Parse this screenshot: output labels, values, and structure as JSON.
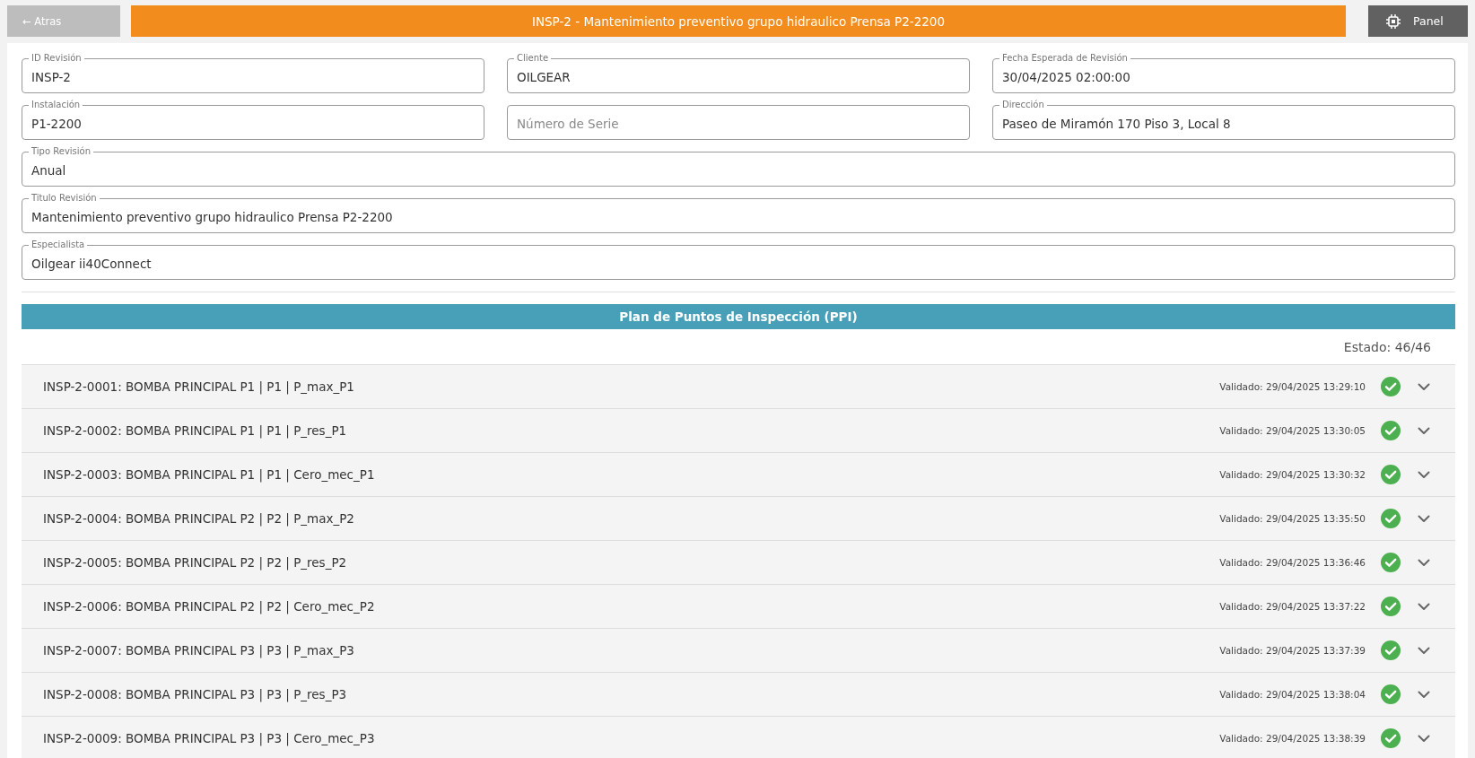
{
  "top_bar": {
    "back_button": "← Atras",
    "title": "INSP-2 - Mantenimiento preventivo grupo hidraulico Prensa P2-2200",
    "panel_button": "Panel"
  },
  "form": {
    "rows": [
      [
        {
          "label": "ID Revisión",
          "value": "INSP-2"
        },
        {
          "label": "Cliente",
          "value": "OILGEAR"
        },
        {
          "label": "Fecha Esperada de Revisión",
          "value": "30/04/2025 02:00:00"
        }
      ],
      [
        {
          "label": "Instalación",
          "value": "P1-2200"
        },
        {
          "placeholder": "Número de Serie"
        },
        {
          "label": "Dirección",
          "value": "Paseo de Miramón 170 Piso 3, Local 8"
        }
      ],
      [
        {
          "label": "Tipo Revisión",
          "value": "Anual"
        }
      ],
      [
        {
          "label": "Titulo Revisión",
          "value": "Mantenimiento preventivo grupo hidraulico Prensa P2-2200"
        }
      ],
      [
        {
          "label": "Especialista",
          "value": "Oilgear ii40Connect"
        }
      ]
    ]
  },
  "inspection_plan": {
    "title": "Plan de Puntos de Inspección (PPI)",
    "status": "Estado: 46/46",
    "items": [
      {
        "label": "INSP-2-0001: BOMBA PRINCIPAL P1 | P1 | P_max_P1",
        "validated_text": "Validado: 29/04/2025 13:29:10",
        "validated": true,
        "expanded": false
      },
      {
        "label": "INSP-2-0002: BOMBA PRINCIPAL P1 | P1 | P_res_P1",
        "validated_text": "Validado: 29/04/2025 13:30:05",
        "validated": true,
        "expanded": false
      },
      {
        "label": "INSP-2-0003: BOMBA PRINCIPAL P1 | P1 | Cero_mec_P1",
        "validated_text": "Validado: 29/04/2025 13:30:32",
        "validated": true,
        "expanded": false
      },
      {
        "label": "INSP-2-0004: BOMBA PRINCIPAL P2 | P2 | P_max_P2",
        "validated_text": "Validado: 29/04/2025 13:35:50",
        "validated": true,
        "expanded": false
      },
      {
        "label": "INSP-2-0005: BOMBA PRINCIPAL P2 | P2 | P_res_P2",
        "validated_text": "Validado: 29/04/2025 13:36:46",
        "validated": true,
        "expanded": false
      },
      {
        "label": "INSP-2-0006: BOMBA PRINCIPAL P2 | P2 | Cero_mec_P2",
        "validated_text": "Validado: 29/04/2025 13:37:22",
        "validated": true,
        "expanded": false
      },
      {
        "label": "INSP-2-0007: BOMBA PRINCIPAL P3 | P3 | P_max_P3",
        "validated_text": "Validado: 29/04/2025 13:37:39",
        "validated": true,
        "expanded": false
      },
      {
        "label": "INSP-2-0008: BOMBA PRINCIPAL P3 | P3 | P_res_P3",
        "validated_text": "Validado: 29/04/2025 13:38:04",
        "validated": true,
        "expanded": false
      },
      {
        "label": "INSP-2-0009: BOMBA PRINCIPAL P3 | P3 | Cero_mec_P3",
        "validated_text": "Validado: 29/04/2025 13:38:39",
        "validated": true,
        "expanded": false
      }
    ]
  }
}
